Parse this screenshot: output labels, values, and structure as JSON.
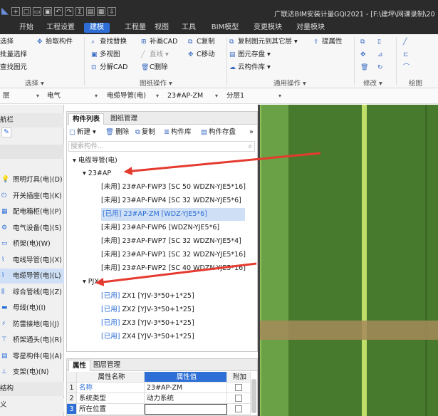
{
  "titlebar": {
    "title": "广联达BIM安装计量GQI2021 - [F:\\建坪\\网课录制\\20",
    "quick_access": [
      "+",
      "▢",
      "▭",
      "▣",
      "↶",
      "↷",
      "Σ",
      "▤",
      "▦",
      "⇩"
    ]
  },
  "menu": {
    "items": [
      "开始",
      "工程设置",
      "建模",
      "视图",
      "工具",
      "BIM模型",
      "变更模块",
      "对量模块"
    ],
    "active": "建模"
  },
  "ribbon": {
    "select": {
      "btn1": "选择",
      "btn2": "批量选择",
      "btn3": "查找图元",
      "pick": "拾取构件",
      "label": "选择 ▾"
    },
    "drawing": {
      "row1": [
        "查找替换",
        "补画CAD",
        "C复制"
      ],
      "row2": [
        "多视图",
        "直线 ▾",
        "C移动"
      ],
      "row3": [
        "分解CAD",
        "C删除"
      ],
      "label": "图纸操作 ▾"
    },
    "general": {
      "row1": [
        "复制图元到其它层 ▾",
        "提属性"
      ],
      "row2": "图元存盘 ▾",
      "row3": "云构件库 ▾",
      "label": "通用操作 ▾"
    },
    "modify": {
      "label": "修改 ▾"
    },
    "draw": {
      "label": "绘图"
    }
  },
  "selectors": {
    "floor": "层",
    "discipline": "电气",
    "type": "电缆导管(电)",
    "component": "23#AP-ZM",
    "layer": "分层1"
  },
  "sidebar": {
    "header_top": "航栏",
    "items": [
      {
        "label": "照明灯具(电)(D)"
      },
      {
        "label": "开关插座(电)(K)"
      },
      {
        "label": "配电箱柜(电)(P)"
      },
      {
        "label": "电气设备(电)(S)"
      },
      {
        "label": "桥架(电)(W)"
      },
      {
        "label": "电线导管(电)(X)"
      },
      {
        "label": "电缆导管(电)(L)"
      },
      {
        "label": "综合管线(电)(Z)"
      },
      {
        "label": "母线(电)(I)"
      },
      {
        "label": "防雷接地(电)(J)"
      },
      {
        "label": "桥架通头(电)(R)"
      },
      {
        "label": "零星构件(电)(A)"
      },
      {
        "label": "支架(电)(N)"
      }
    ],
    "footer1": "结构",
    "footer2": "义"
  },
  "component_panel": {
    "tabs": [
      "构件列表",
      "图纸管理"
    ],
    "tools": [
      "新建 ▾",
      "删除",
      "复制",
      "构件库",
      "构件存盘",
      "»"
    ],
    "search_placeholder": "搜索构件...",
    "root": "电缆导管(电)",
    "group1": "23#AP",
    "group1_items": [
      {
        "status": "[未用]",
        "name": "23#AP-FWP3 [SC 50 WDZN-YJE5*16]"
      },
      {
        "status": "[未用]",
        "name": "23#AP-FWP4 [SC 32 WDZN-YJE5*6]"
      },
      {
        "status": "[已用]",
        "name": "23#AP-ZM [WDZ-YJE5*6]"
      },
      {
        "status": "[未用]",
        "name": "23#AP-FWP6 [WDZN-YJE5*6]"
      },
      {
        "status": "[未用]",
        "name": "23#AP-FWP7 [SC 32 WDZN-YJE5*4]"
      },
      {
        "status": "[未用]",
        "name": "23#AP-FWP1 [SC 32 WDZN-YJE5*16]"
      },
      {
        "status": "[未用]",
        "name": "23#AP-FWP2 [SC 40 WDZN-YJE5*16]"
      }
    ],
    "group2": "PJX",
    "group2_items": [
      {
        "status": "[已用]",
        "name": "ZX1 [YJV-3*50+1*25]"
      },
      {
        "status": "[已用]",
        "name": "ZX2 [YJV-3*50+1*25]"
      },
      {
        "status": "[已用]",
        "name": "ZX3 [YJV-3*50+1*25]"
      },
      {
        "status": "[已用]",
        "name": "ZX4 [YJV-3*50+1*25]"
      }
    ]
  },
  "properties": {
    "tabs": [
      "属性",
      "图层管理"
    ],
    "headers": [
      "属性名称",
      "属性值",
      "附加"
    ],
    "rows": [
      {
        "num": "1",
        "name": "名称",
        "value": "23#AP-ZM"
      },
      {
        "num": "2",
        "name": "系统类型",
        "value": "动力系统"
      },
      {
        "num": "3",
        "name": "所在位置",
        "value": ""
      }
    ]
  },
  "colors": {
    "accent": "#2d6fd6",
    "arrow": "#e53a2f",
    "canvas_green": "#477a2c"
  }
}
